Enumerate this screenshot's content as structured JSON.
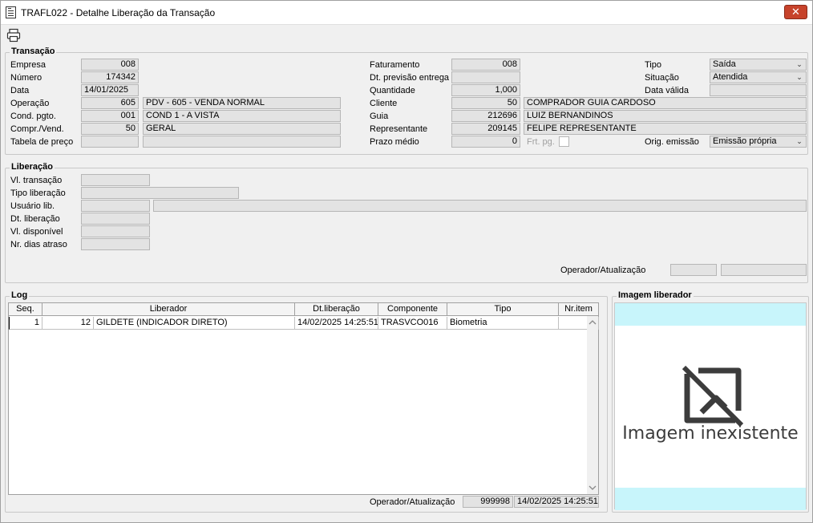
{
  "window": {
    "title": "TRAFL022 - Detalhe Liberação da Transação",
    "close": "✕"
  },
  "transacao": {
    "group_label": "Transação",
    "empresa": {
      "label": "Empresa",
      "value": "008"
    },
    "numero": {
      "label": "Número",
      "value": "174342"
    },
    "data": {
      "label": "Data",
      "value": "14/01/2025"
    },
    "operacao": {
      "label": "Operação",
      "code": "605",
      "desc": "PDV - 605 - VENDA NORMAL"
    },
    "cond_pgto": {
      "label": "Cond. pgto.",
      "code": "001",
      "desc": "COND 1 - A VISTA"
    },
    "compr_vend": {
      "label": "Compr./Vend.",
      "code": "50",
      "desc": "GERAL"
    },
    "tabela_preco": {
      "label": "Tabela de preço",
      "code": "",
      "desc": ""
    },
    "faturamento": {
      "label": "Faturamento",
      "value": "008"
    },
    "dt_previsao": {
      "label": "Dt. previsão entrega",
      "value": ""
    },
    "quantidade": {
      "label": "Quantidade",
      "value": "1,000"
    },
    "cliente": {
      "label": "Cliente",
      "code": "50",
      "desc": "COMPRADOR GUIA CARDOSO"
    },
    "guia": {
      "label": "Guia",
      "code": "212696",
      "desc": "LUIZ BERNANDINOS"
    },
    "representante": {
      "label": "Representante",
      "code": "209145",
      "desc": "FELIPE REPRESENTANTE"
    },
    "prazo_medio": {
      "label": "Prazo médio",
      "value": "0"
    },
    "frt_pg": {
      "label": "Frt. pg."
    },
    "tipo": {
      "label": "Tipo",
      "value": "Saída"
    },
    "situacao": {
      "label": "Situação",
      "value": "Atendida"
    },
    "data_valida": {
      "label": "Data válida",
      "value": ""
    },
    "orig_emissao": {
      "label": "Orig. emissão",
      "value": "Emissão própria"
    }
  },
  "liberacao": {
    "group_label": "Liberação",
    "vl_transacao": {
      "label": "Vl. transação",
      "value": ""
    },
    "tipo_liberacao": {
      "label": "Tipo liberação",
      "value": ""
    },
    "usuario_lib": {
      "label": "Usuário lib.",
      "code": "",
      "name": ""
    },
    "dt_liberacao": {
      "label": "Dt. liberação",
      "value": ""
    },
    "vl_disponivel": {
      "label": "Vl. disponível",
      "value": ""
    },
    "nr_dias_atraso": {
      "label": "Nr. dias atraso",
      "value": ""
    },
    "operador_label": "Operador/Atualização",
    "operador_code": "",
    "operador_date": ""
  },
  "log": {
    "group_label": "Log",
    "columns": [
      "Seq.",
      "Liberador",
      "Dt.liberação",
      "Componente",
      "Tipo",
      "Nr.item"
    ],
    "rows": [
      {
        "seq": "1",
        "liberador_code": "12",
        "liberador_name": "GILDETE (INDICADOR DIRETO)",
        "dt": "14/02/2025 14:25:51",
        "componente": "TRASVCO016",
        "tipo": "Biometria",
        "nr_item": ""
      }
    ],
    "operador_label": "Operador/Atualização",
    "operador_code": "999998",
    "operador_date": "14/02/2025 14:25:51"
  },
  "imagem": {
    "group_label": "Imagem liberador",
    "no_image_text": "Imagem inexistente"
  },
  "colors": {
    "field_bg": "#e3e3e3",
    "image_band": "#c8f5fb",
    "close_btn": "#c7432b"
  }
}
